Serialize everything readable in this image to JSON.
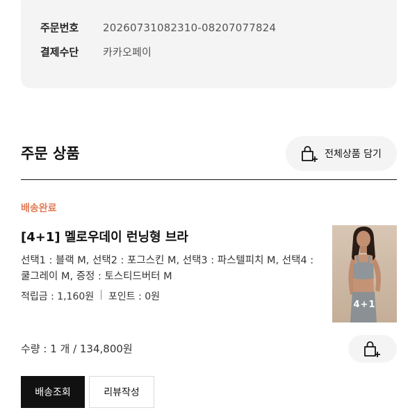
{
  "order_info": {
    "order_number_label": "주문번호",
    "order_number_value": "20260731082310-08207077824",
    "payment_label": "결제수단",
    "payment_value": "카카오페이"
  },
  "section": {
    "title": "주문 상품",
    "add_all_label": "전체상품 담기",
    "add_all_icon": "cart-add-icon"
  },
  "product": {
    "status": "배송완료",
    "name": "[4+1] 멜로우데이 런닝형 브라",
    "options": "선택1 : 블랙 M, 선택2 : 포그스킨 M, 선택3 : 파스텔피치 M, 선택4 : 쿨그레이 M, 증정 : 토스티드버터 M",
    "points_earned": "적립금 : 1,160원",
    "points_separator": "|",
    "points_used": "포인트 : 0원",
    "thumbnail_badge": "4+1",
    "quantity_price": "수량 : 1 개 / 134,800원",
    "cart_icon": "cart-add-icon"
  },
  "actions": {
    "track_label": "배송조회",
    "review_label": "리뷰작성"
  },
  "colors": {
    "status": "#e07a55",
    "card_bg": "#f4f4f4",
    "primary_button": "#111111"
  }
}
